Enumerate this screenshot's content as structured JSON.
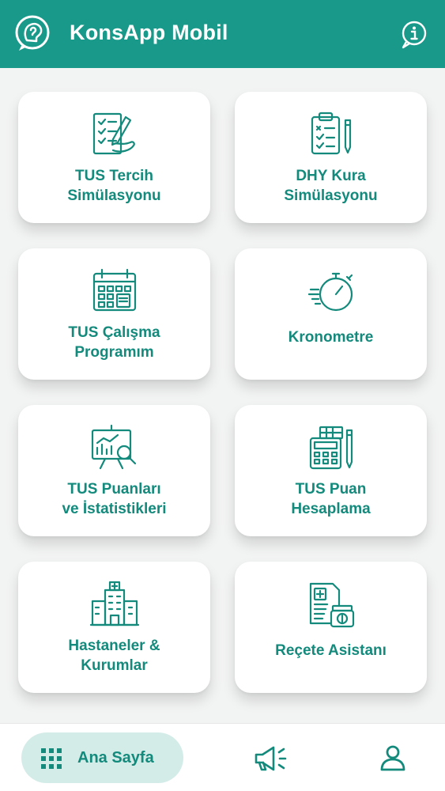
{
  "app": {
    "title": "KonsApp Mobil",
    "colors": {
      "primary": "#19998a",
      "text_primary": "#138a7c",
      "background": "#f2f3f3",
      "card": "#ffffff",
      "nav_active_bg": "#d3ece8"
    },
    "logo_icon": "consultant-head-chat-icon",
    "info_icon": "info-icon"
  },
  "menu": {
    "items": [
      {
        "label": "TUS Tercih\nSimülasyonu",
        "icon": "checklist-pen-icon"
      },
      {
        "label": "DHY Kura\nSimülasyonu",
        "icon": "clipboard-pencil-icon"
      },
      {
        "label": "TUS Çalışma\nProgramım",
        "icon": "calendar-icon"
      },
      {
        "label": "Kronometre",
        "icon": "stopwatch-icon"
      },
      {
        "label": "TUS Puanları\nve İstatistikleri",
        "icon": "chart-board-magnifier-icon"
      },
      {
        "label": "TUS Puan\nHesaplama",
        "icon": "calculator-pencil-icon"
      },
      {
        "label": "Hastaneler &\nKurumlar",
        "icon": "hospital-icon"
      },
      {
        "label": "Reçete Asistanı",
        "icon": "prescription-pill-bottle-icon"
      }
    ]
  },
  "bottom_nav": {
    "home_label": "Ana Sayfa",
    "home_icon": "grid-icon",
    "announcements_icon": "megaphone-icon",
    "profile_icon": "user-icon"
  }
}
